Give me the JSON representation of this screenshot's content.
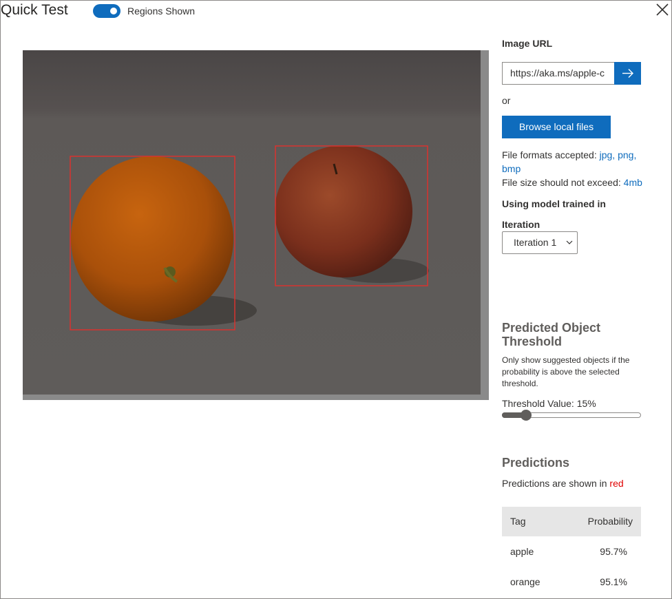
{
  "header": {
    "title": "Quick Test",
    "toggle_label": "Regions Shown",
    "toggle_on": true
  },
  "image_panel": {
    "regions": [
      {
        "tag": "orange"
      },
      {
        "tag": "apple"
      }
    ],
    "region_color": "#d9322f"
  },
  "side": {
    "image_url_label": "Image URL",
    "image_url_value": "https://aka.ms/apple-c",
    "or_text": "or",
    "browse_label": "Browse local files",
    "formats_prefix": "File formats accepted: ",
    "format_jpg": "jpg,",
    "format_png": "png,",
    "format_bmp": "bmp",
    "size_prefix": "File size should not exceed: ",
    "size_value": "4mb",
    "model_label": "Using model trained in",
    "iteration_label": "Iteration",
    "iteration_value": "Iteration 1",
    "threshold_title": "Predicted Object Threshold",
    "threshold_desc": "Only show suggested objects if the probability is above the selected threshold.",
    "threshold_label": "Threshold Value: 15%",
    "threshold_value": 0.15,
    "predictions_title": "Predictions",
    "predictions_prefix": "Predictions are shown in ",
    "predictions_color_word": "red",
    "table": {
      "headers": [
        "Tag",
        "Probability"
      ],
      "rows": [
        {
          "tag": "apple",
          "probability": "95.7%"
        },
        {
          "tag": "orange",
          "probability": "95.1%"
        }
      ]
    }
  },
  "colors": {
    "accent": "#0f6cbd",
    "prediction_red": "#e00000"
  }
}
